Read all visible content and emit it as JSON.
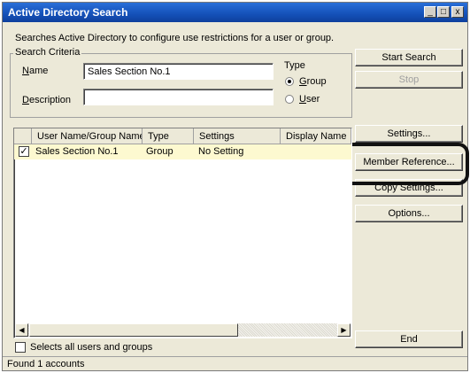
{
  "window": {
    "title": "Active Directory Search",
    "controls": {
      "minimize": "_",
      "maximize": "□",
      "close": "x"
    }
  },
  "description": "Searches Active Directory to configure use restrictions for a user or group.",
  "search_criteria": {
    "label": "Search Criteria",
    "name_label": "Name",
    "name_value": "Sales Section No.1",
    "description_label": "Description",
    "description_value": "",
    "type_label": "Type",
    "type_options": [
      {
        "label": "Group",
        "selected": true
      },
      {
        "label": "User",
        "selected": false
      }
    ]
  },
  "buttons": {
    "start_search": "Start Search",
    "stop": "Stop",
    "settings": "Settings...",
    "member_reference": "Member Reference...",
    "copy_settings": "Copy Settings...",
    "options": "Options...",
    "end": "End"
  },
  "list": {
    "columns": [
      "User Name/Group Name",
      "Type",
      "Settings",
      "Display Name"
    ],
    "rows": [
      {
        "checked": true,
        "name": "Sales Section No.1",
        "type": "Group",
        "settings": "No Setting",
        "display_name": ""
      }
    ]
  },
  "select_all": {
    "label": "Selects all users and groups",
    "checked": false
  },
  "status": "Found 1 accounts"
}
